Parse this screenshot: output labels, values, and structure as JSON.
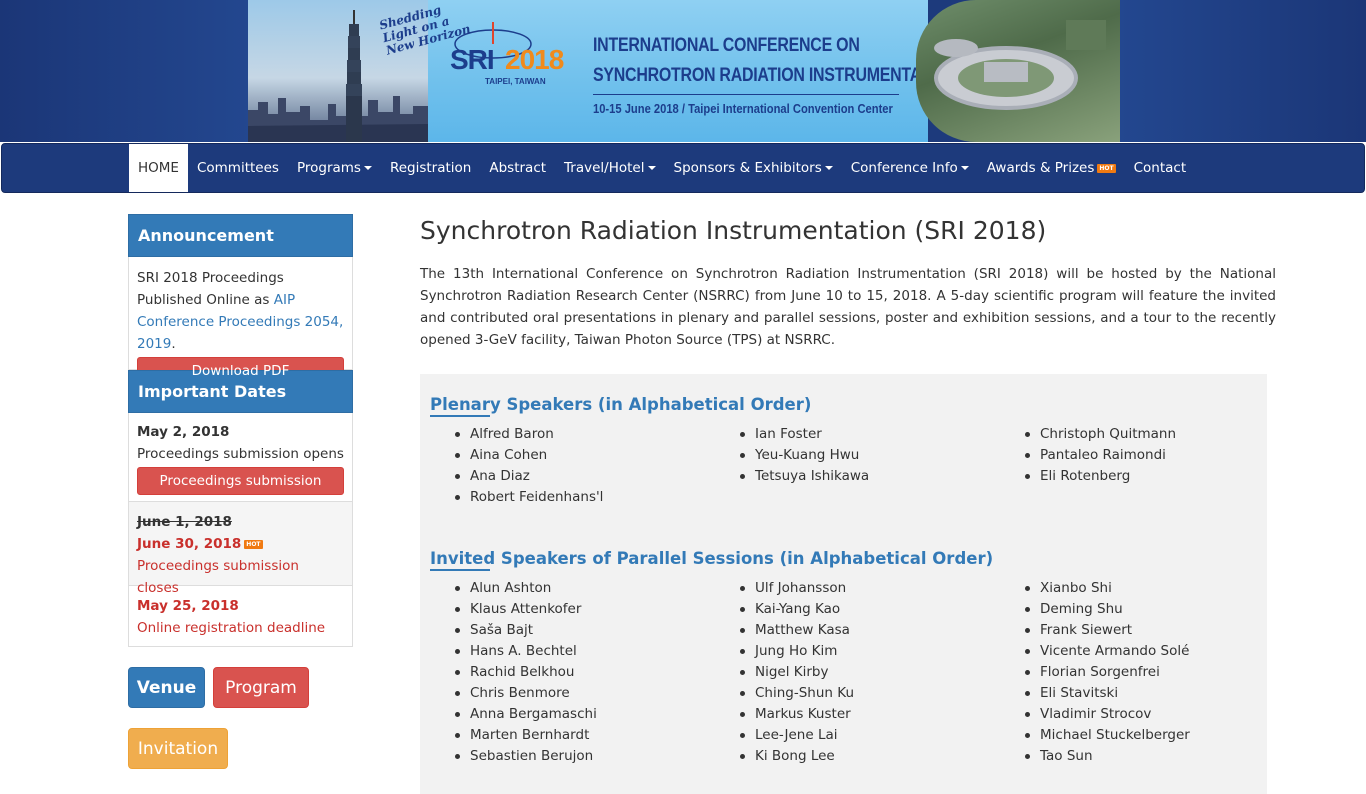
{
  "banner": {
    "slogan": "Shedding Light on a New Horizon",
    "logo_sri": "SRI",
    "logo_year": "2018",
    "logo_city": "TAIPEI, TAIWAN",
    "conf_line1": "INTERNATIONAL CONFERENCE ON",
    "conf_line2": "SYNCHROTRON RADIATION INSTRUMENTATION",
    "conf_dates": "10-15 June 2018 / Taipei International Convention Center"
  },
  "nav": {
    "home": "HOME",
    "committees": "Committees",
    "programs": "Programs",
    "registration": "Registration",
    "abstract": "Abstract",
    "travel": "Travel/Hotel",
    "sponsors": "Sponsors & Exhibitors",
    "conference_info": "Conference Info",
    "awards": "Awards & Prizes",
    "hot": "HOT",
    "contact": "Contact"
  },
  "sidebar": {
    "announcement_title": "Announcement",
    "announcement_text": "SRI 2018 Proceedings Published Online as ",
    "announcement_link": "AIP Conference Proceedings 2054, 2019",
    "announcement_end": ".",
    "download_pdf": "Download PDF",
    "dates_title": "Important Dates",
    "date1": "May 2, 2018",
    "date1_desc": "Proceedings submission opens",
    "date1_button": "Proceedings submission",
    "date2_old": "June 1, 2018",
    "date2_new": "June 30, 2018",
    "date2_hot": "HOT",
    "date2_desc": "Proceedings submission closes",
    "date3": "May 25, 2018",
    "date3_desc": "Online registration deadline",
    "venue": "Venue",
    "program": "Program",
    "invitation": "Invitation"
  },
  "main": {
    "title": "Synchrotron Radiation Instrumentation (SRI 2018)",
    "intro": "The 13th International Conference on Synchrotron Radiation Instrumentation (SRI 2018) will be hosted by the National Synchrotron Radiation Research Center (NSRRC) from June 10 to 15, 2018. A 5-day scientific program will feature the invited and contributed oral presentations in plenary and parallel sessions, poster and exhibition sessions, and a tour to the recently opened 3-GeV facility, Taiwan Photon Source (TPS) at NSRRC.",
    "plenary_title": "Plenary Speakers (in Alphabetical Order)",
    "plenary": [
      [
        "Alfred Baron",
        "Aina Cohen",
        "Ana Diaz",
        "Robert Feidenhans'l"
      ],
      [
        "Ian Foster",
        "Yeu-Kuang Hwu",
        "Tetsuya Ishikawa"
      ],
      [
        "Christoph Quitmann",
        "Pantaleo Raimondi",
        "Eli Rotenberg"
      ]
    ],
    "invited_title": "Invited Speakers of Parallel Sessions (in Alphabetical Order)",
    "invited": [
      [
        "Alun Ashton",
        "Klaus Attenkofer",
        "Saša Bajt",
        "Hans A. Bechtel",
        "Rachid Belkhou",
        "Chris Benmore",
        "Anna Bergamaschi",
        "Marten Bernhardt",
        "Sebastien Berujon"
      ],
      [
        "Ulf Johansson",
        "Kai-Yang Kao",
        "Matthew Kasa",
        "Jung Ho Kim",
        "Nigel Kirby",
        "Ching-Shun Ku",
        "Markus Kuster",
        "Lee-Jene Lai",
        "Ki Bong Lee"
      ],
      [
        "Xianbo Shi",
        "Deming Shu",
        "Frank Siewert",
        "Vicente Armando Solé",
        "Florian Sorgenfrei",
        "Eli Stavitski",
        "Vladimir Strocov",
        "Michael Stuckelberger",
        "Tao Sun"
      ]
    ]
  }
}
